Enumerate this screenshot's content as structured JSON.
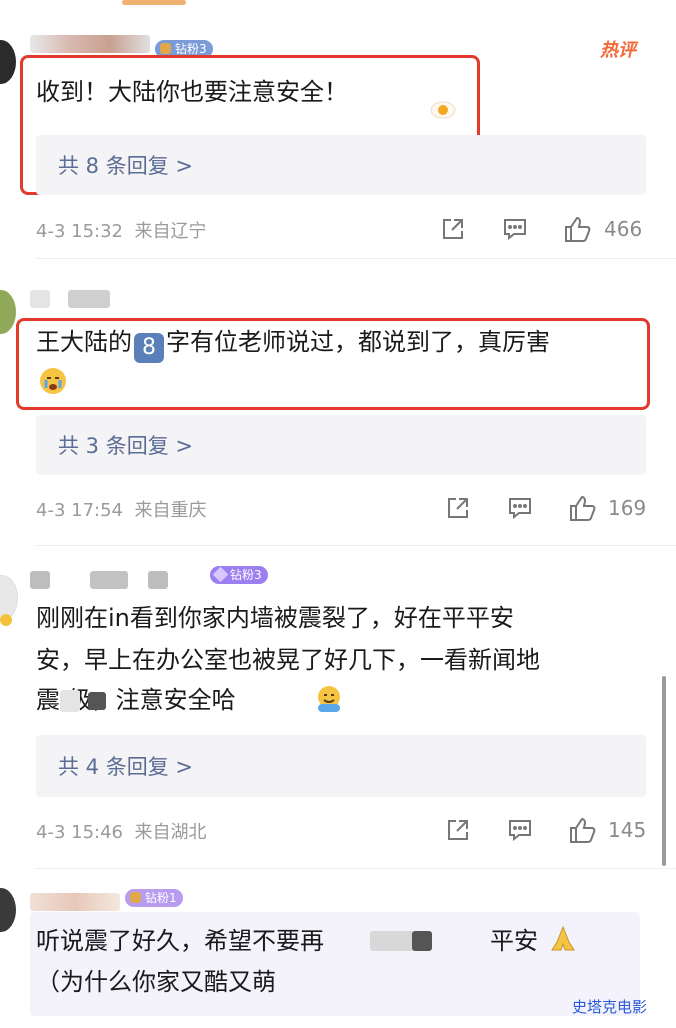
{
  "hot_label": "热评",
  "comments": [
    {
      "badge": "钻粉3",
      "text_lines": [
        "收到！大陆你也要注意安全！"
      ],
      "reply_label": "共 8 条回复 >",
      "date": "4-3 15:32",
      "location": "来自辽宁",
      "likes": "466"
    },
    {
      "badge": "",
      "text_line1_pre": "王大陆的",
      "text_line1_emoji": "8",
      "text_line1_post": "字有位老师说过，都说到了，真厉害",
      "reply_label": "共 3 条回复 >",
      "date": "4-3 17:54",
      "location": "来自重庆",
      "likes": "169"
    },
    {
      "badge": "钻粉3",
      "text_lines": [
        "刚刚在in看到你家内墙被震裂了，好在平平安",
        "安，早上在办公室也被晃了好几下，一看新闻地",
        "震     级，注意安全哈"
      ],
      "reply_label": "共 4 条回复 >",
      "date": "4-3 15:46",
      "location": "来自湖北",
      "likes": "145"
    },
    {
      "badge": "钻粉1",
      "text_line1_pre": "听说震了好久，希望不要再",
      "text_line1_post": "平安",
      "text_line2": "（为什么你家又酷又萌"
    }
  ],
  "watermark": "史塔克电影",
  "colors": {
    "accent_red": "#e23a2c",
    "reply_blue": "#5b6c95",
    "badge_purple": "#9b7ef0",
    "badge_gold": "#e0a84a"
  }
}
